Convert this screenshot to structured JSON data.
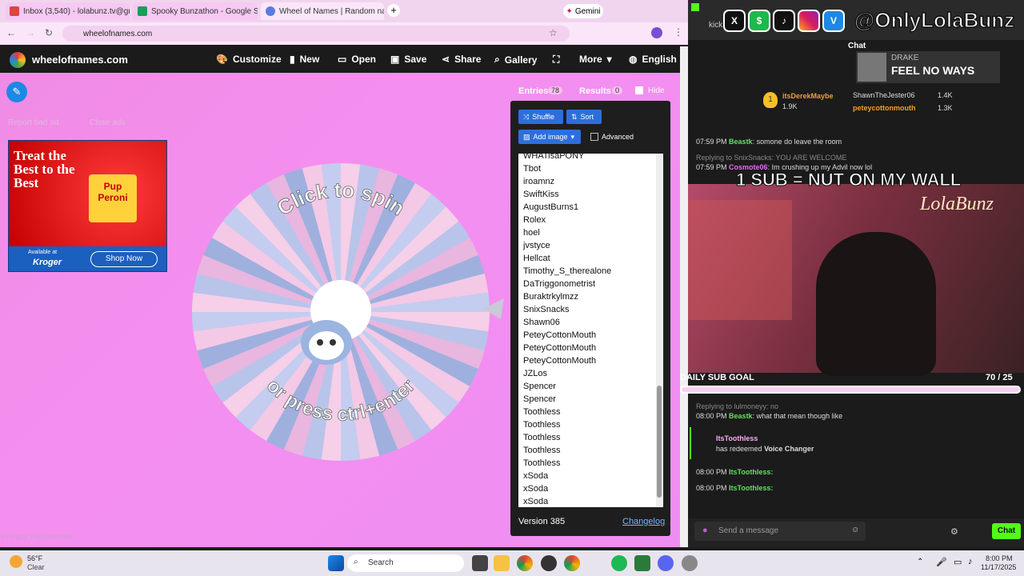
{
  "tabs": [
    {
      "label": "Inbox (3,540) - lolabunz.tv@gm",
      "icon_color": "#d44"
    },
    {
      "label": "Spooky Bunzathon - Google Sh",
      "icon_color": "#1a9e55"
    },
    {
      "label": "Wheel of Names | Random nam",
      "icon_color": "#5b7be0"
    }
  ],
  "gemini": "Gemini",
  "url": "wheelofnames.com",
  "site": {
    "brand": "wheelofnames.com",
    "nav": [
      "Customize",
      "New",
      "Open",
      "Save",
      "Share",
      "Gallery",
      "More",
      "English"
    ],
    "report": "Report bad ad",
    "close_ads": "Close ads",
    "ad": {
      "headline": "Treat the Best to the Best",
      "product": "Pup Peroni",
      "available": "Available at",
      "store": "Kroger",
      "cta": "Shop Now"
    },
    "privacy": "Privacy Preferences",
    "wheel": {
      "top": "Click to spin",
      "bottom": "or press ctrl+enter"
    },
    "entries_label": "Entries",
    "entries_count": "78",
    "results_label": "Results",
    "results_count": "0",
    "hide": "Hide",
    "shuffle": "Shuffle",
    "sort": "Sort",
    "add_image": "Add image",
    "advanced": "Advanced",
    "entries": [
      "WHATisaPONY",
      "Tbot",
      "iroamnz",
      "SwiftKiss",
      "AugustBurns1",
      "Rolex",
      "hoel",
      "jvstyce",
      "Hellcat",
      "Timothy_S_therealone",
      "DaTriggonometrist",
      "Buraktrkylmzz",
      "SnixSnacks",
      "Shawn06",
      "PeteyCottonMouth",
      "PeteyCottonMouth",
      "PeteyCottonMouth",
      "JZLos",
      "Spencer",
      "Spencer",
      "Toothless",
      "Toothless",
      "Toothless",
      "Toothless",
      "Toothless",
      "xSoda",
      "xSoda",
      "xSoda"
    ],
    "version": "Version 385",
    "changelog": "Changelog"
  },
  "stream": {
    "handle": "@OnlyLolaBunz",
    "chat_title": "Chat",
    "kick": "kick",
    "drake_name": "DRAKE",
    "drake_text": "FEEL NO WAYS",
    "top1": "itsDerekMaybe",
    "top1_val": "1.9K",
    "top2": "ShawnTheJester06",
    "top2_val": "1.4K",
    "top3": "peteycottonmouth",
    "top3_val": "1.3K",
    "m1_time": "07:59 PM",
    "m1_user": "Beastk",
    "m1_text": "somone do leave the room",
    "m2_reply": "Replying to SnixSnacks: YOU ARE WELCOME",
    "m2_time": "07:59 PM",
    "m2_user": "Cosmote06",
    "m2_text": "Im crushing up my Advil now lol",
    "banner": "1 SUB = NUT ON MY WALL",
    "neon": "LolaBunz",
    "goal_label": "DAILY SUB GOAL",
    "goal_val": "70 / 25",
    "m3_reply": "Replying to lulmoneyy: no",
    "m3_time": "08:00 PM",
    "m3_user": "Beastk",
    "m3_text": "what that mean though like",
    "redeem_user": "ItsToothless",
    "redeem_text": "has redeemed",
    "redeem_item": "Voice Changer",
    "m4_time": "08:00 PM",
    "m4_user": "ItsToothless:",
    "m5_time": "08:00 PM",
    "m5_user": "ItsToothless:",
    "send_placeholder": "Send a message",
    "chat_button": "Chat"
  },
  "taskbar": {
    "temp": "56°F",
    "weather": "Clear",
    "search": "Search",
    "time": "8:00 PM",
    "date": "11/17/2025"
  }
}
